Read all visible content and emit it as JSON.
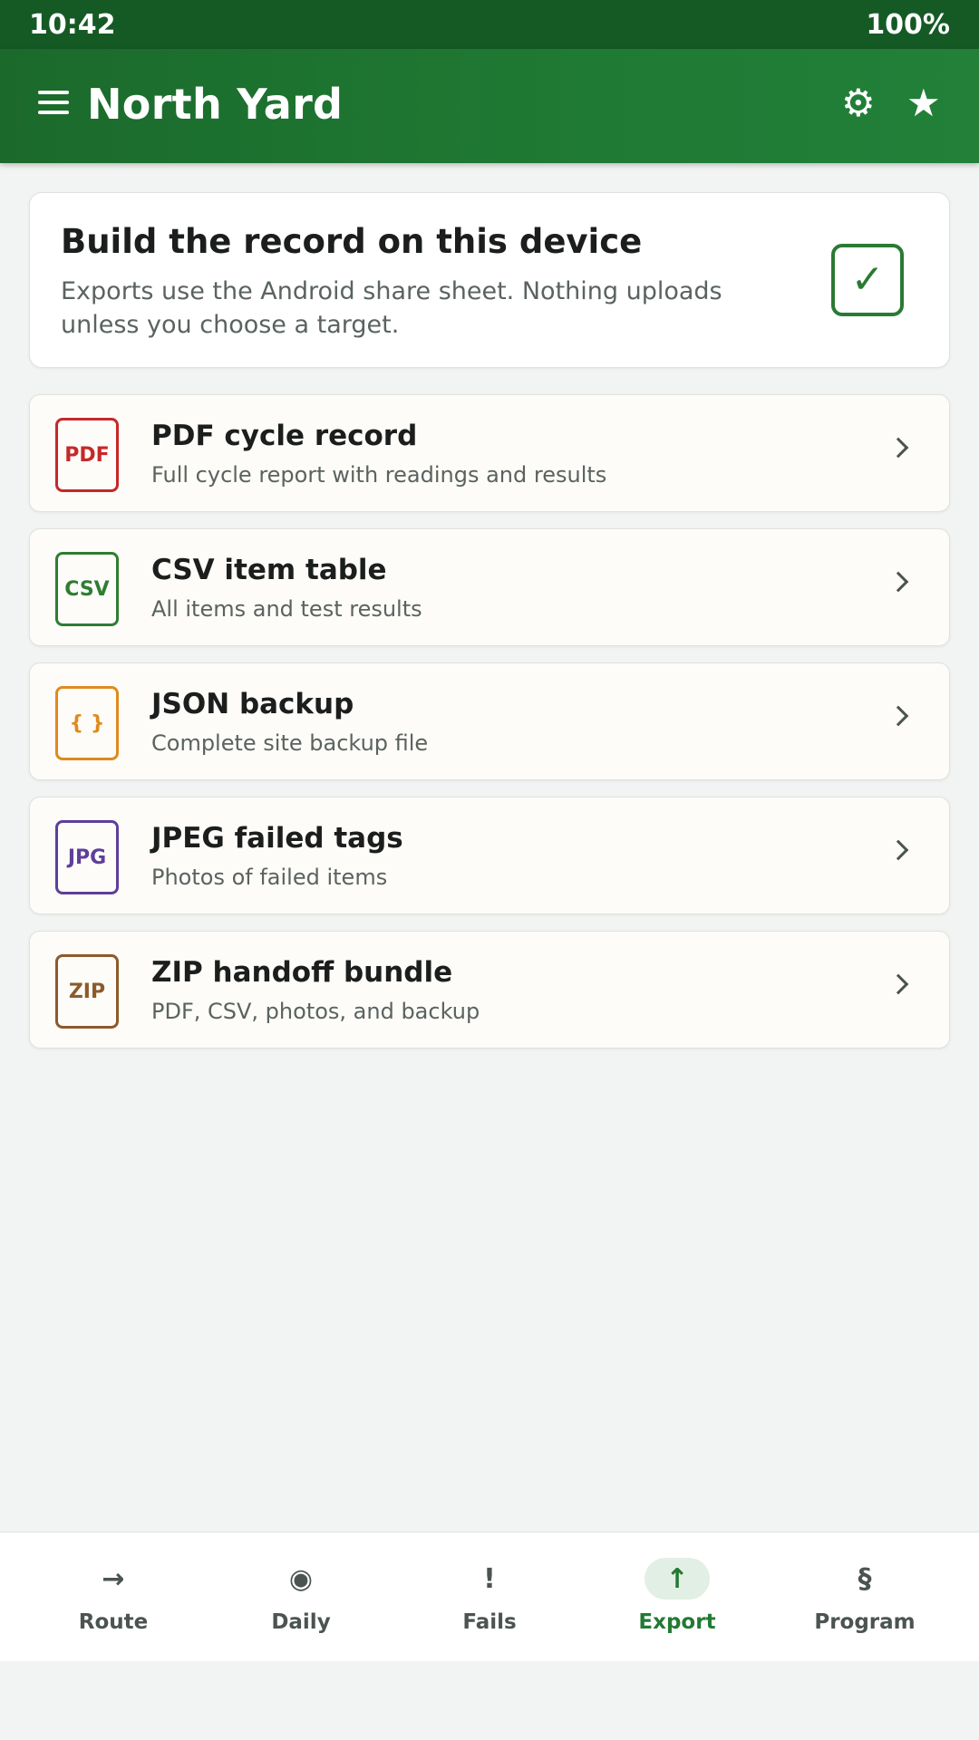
{
  "status": {
    "time": "10:42",
    "battery": "100%"
  },
  "app_bar": {
    "title": "North Yard",
    "menu_icon": "menu-icon",
    "settings_icon": "gear-icon",
    "favorite_icon": "star-icon"
  },
  "intro": {
    "title": "Build the record on this device",
    "text": "Exports use the Android share sheet. Nothing uploads unless you choose a target.",
    "check_glyph": "✓"
  },
  "exports": [
    {
      "badge": "PDF",
      "color": "#c62828",
      "title": "PDF cycle record",
      "subtitle": "Full cycle report with readings and results"
    },
    {
      "badge": "CSV",
      "color": "#2e7d32",
      "title": "CSV item table",
      "subtitle": "All items and test results"
    },
    {
      "badge": "{ }",
      "color": "#e08a1e",
      "title": "JSON backup",
      "subtitle": "Complete site backup file"
    },
    {
      "badge": "JPG",
      "color": "#5e3f9a",
      "title": "JPEG failed tags",
      "subtitle": "Photos of failed items"
    },
    {
      "badge": "ZIP",
      "color": "#8d5a2b",
      "title": "ZIP handoff bundle",
      "subtitle": "PDF, CSV, photos, and backup"
    }
  ],
  "nav": [
    {
      "glyph": "→",
      "label": "Route",
      "active": false
    },
    {
      "glyph": "◉",
      "label": "Daily",
      "active": false
    },
    {
      "glyph": "!",
      "label": "Fails",
      "active": false
    },
    {
      "glyph": "↑",
      "label": "Export",
      "active": true
    },
    {
      "glyph": "§",
      "label": "Program",
      "active": false
    }
  ],
  "colors": {
    "primary": "#1f7a33",
    "status_bar": "#155a24",
    "accent_active": "#237a33"
  }
}
